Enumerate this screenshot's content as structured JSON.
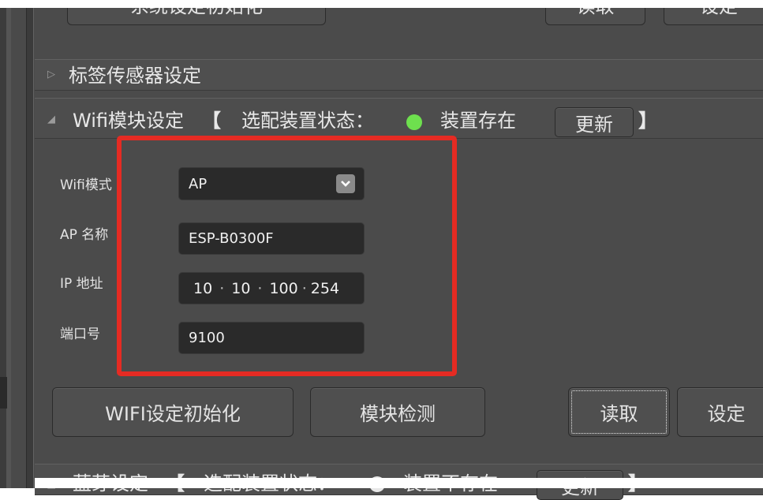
{
  "top_buttons": {
    "reset_label": "系统设定初始化",
    "read_label": "读取",
    "set_label": "设定"
  },
  "sections": {
    "tag_sensor": {
      "title": "标签传感器设定"
    },
    "wifi": {
      "title": "Wifi模块设定",
      "bracket_open": "【",
      "status_prefix": "选配装置状态：",
      "status_text": "装置存在",
      "status_color": "#6ee04e",
      "refresh_label": "更新",
      "bracket_close": "】"
    },
    "bluetooth": {
      "title": "蓝芽设定",
      "bracket_open": "【",
      "status_prefix": "选配装置状态：",
      "status_text": "装置不存在",
      "refresh_label": "更新",
      "bracket_close": "】"
    }
  },
  "wifi_form": {
    "mode_label": "Wifi模式",
    "mode_value": "AP",
    "ap_name_label": "AP 名称",
    "ap_name_value": "ESP-B0300F",
    "ip_label": "IP 地址",
    "ip": [
      "10",
      "10",
      "100",
      "254"
    ],
    "ip_sep": "·",
    "port_label": "端口号",
    "port_value": "9100"
  },
  "wifi_buttons": {
    "init_label": "WIFI设定初始化",
    "detect_label": "模块检测",
    "read_label": "读取",
    "set_label": "设定"
  },
  "colors": {
    "panel_bg": "#4b4b4b",
    "field_bg": "#2a2a2a",
    "highlight_border": "#e52b23"
  },
  "icons": {
    "collapsed": "triangle-right-icon",
    "expanded": "triangle-down-icon",
    "dropdown": "chevron-down-icon"
  }
}
